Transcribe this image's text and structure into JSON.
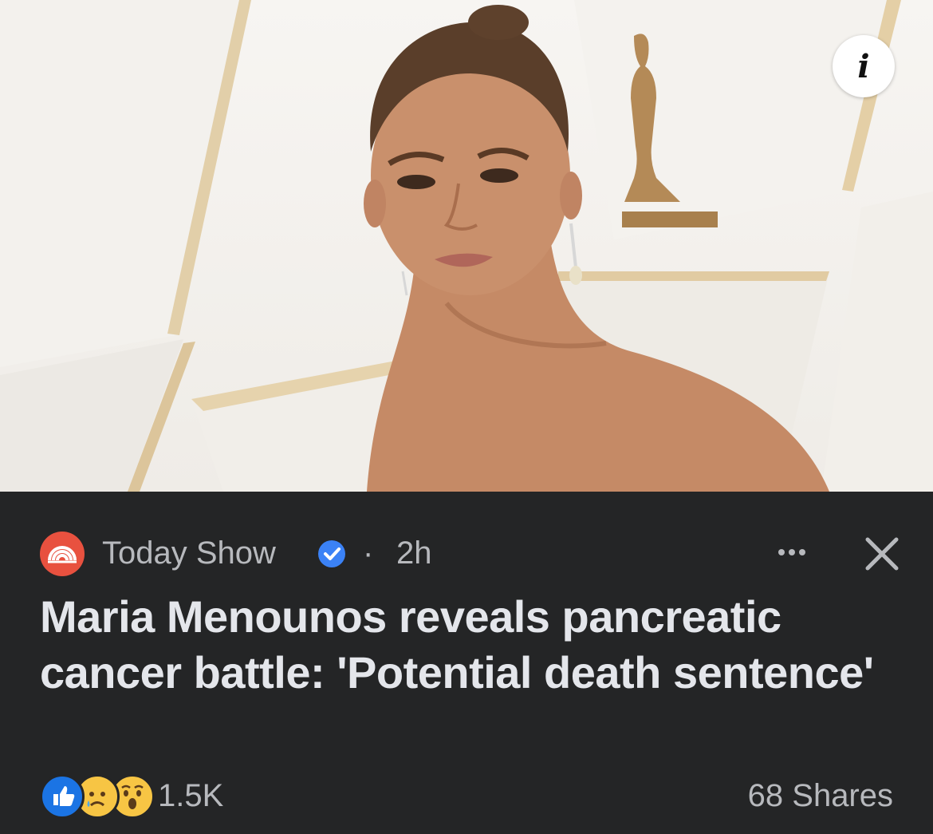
{
  "post": {
    "image_alt": "Woman with hair in a high bun at a red-carpet backdrop with a gold statuette",
    "info_icon": "info-icon",
    "info_label": "i",
    "source": {
      "name": "Today Show",
      "logo_icon": "rainbow-logo-icon",
      "verified_icon": "verified-badge-icon",
      "separator": "·",
      "time": "2h"
    },
    "menu_icon": "more-dots-icon",
    "close_icon": "close-icon",
    "headline": "Maria Menounos reveals pancreatic cancer battle: 'Potential death sentence'",
    "reactions": {
      "icons": [
        "like-reaction-icon",
        "sad-reaction-icon",
        "wow-reaction-icon"
      ],
      "count": "1.5K"
    },
    "shares": "68 Shares"
  },
  "colors": {
    "background": "#242526",
    "text_primary": "#e4e6eb",
    "text_secondary": "#b7b9bd",
    "brand_logo": "#e8513f",
    "like_blue": "#1b74e4",
    "verified_blue": "#3b82f6"
  }
}
